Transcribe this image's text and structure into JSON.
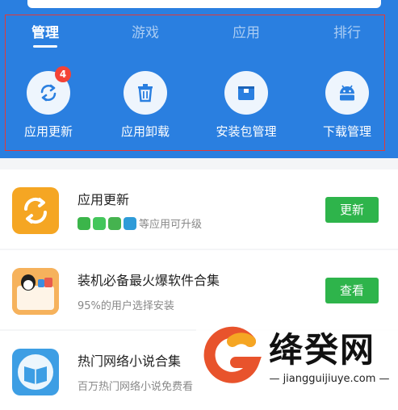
{
  "tabs": [
    {
      "label": "管理",
      "active": true
    },
    {
      "label": "游戏",
      "active": false
    },
    {
      "label": "应用",
      "active": false
    },
    {
      "label": "排行",
      "active": false
    }
  ],
  "tools": [
    {
      "label": "应用更新",
      "icon": "refresh-icon",
      "badge": "4"
    },
    {
      "label": "应用卸载",
      "icon": "trash-icon"
    },
    {
      "label": "安装包管理",
      "icon": "package-icon"
    },
    {
      "label": "下载管理",
      "icon": "android-icon"
    }
  ],
  "cards": [
    {
      "title": "应用更新",
      "subtitle": "等应用可升级",
      "button": "更新",
      "icon": "update-app-icon"
    },
    {
      "title": "装机必备最火爆软件合集",
      "subtitle": "95%的用户选择安装",
      "button": "查看",
      "icon": "qq-bag-icon"
    },
    {
      "title": "热门网络小说合集",
      "subtitle": "百万热门网络小说免费看",
      "icon": "book-icon"
    }
  ],
  "watermark": {
    "title": "绛癸网",
    "url": "— jiangguijiuye.com —"
  },
  "colors": {
    "header_blue": "#2a7fe0",
    "button_green": "#2eb44b",
    "badge_red": "#f44336",
    "highlight_red": "#e53935"
  }
}
